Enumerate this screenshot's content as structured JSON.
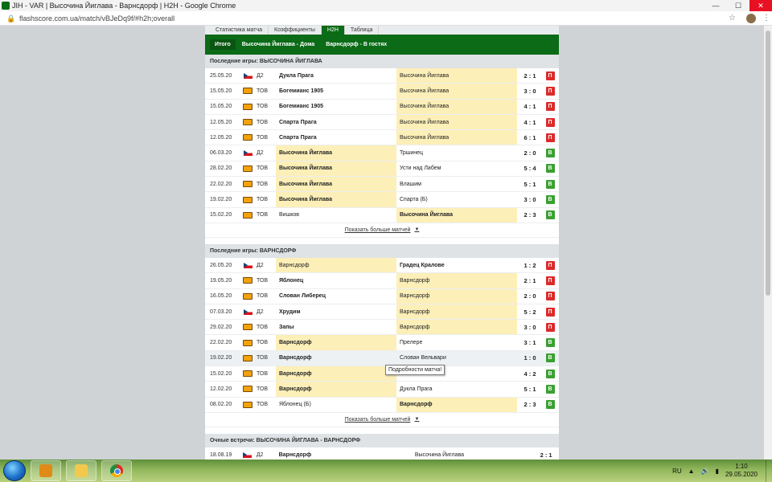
{
  "window": {
    "title": "JIH - VAR | Высочина Йиглава - Варнсдорф | H2H - Google Chrome",
    "url": "flashscore.com.ua/match/vBJeDq9f/#h2h;overall",
    "min": "—",
    "max": "☐",
    "close": "✕"
  },
  "top_tabs": [
    "Статистика матча",
    "Коэффициенты",
    "H2H",
    "Таблица"
  ],
  "sub_tabs": [
    "Итого",
    "Высочина Йиглава - Дома",
    "Варнсдорф - В гостях"
  ],
  "section1": {
    "title": "Последние игры: ВЫСОЧИНА ЙИГЛАВА",
    "rows": [
      {
        "date": "25.05.20",
        "flag": "cz",
        "comp": "Д2",
        "home": "Дукла Прага",
        "away": "Высочина Йиглава",
        "score": "2 : 1",
        "result": "П",
        "hl": "away",
        "bold": "home"
      },
      {
        "date": "15.05.20",
        "flag": "club",
        "comp": "ТОВ",
        "home": "Богемианс 1905",
        "away": "Высочина Йиглава",
        "score": "3 : 0",
        "result": "П",
        "hl": "away",
        "bold": "home"
      },
      {
        "date": "15.05.20",
        "flag": "club",
        "comp": "ТОВ",
        "home": "Богемианс 1905",
        "away": "Высочина Йиглава",
        "score": "4 : 1",
        "result": "П",
        "hl": "away",
        "bold": "home"
      },
      {
        "date": "12.05.20",
        "flag": "club",
        "comp": "ТОВ",
        "home": "Спарта Прага",
        "away": "Высочина Йиглава",
        "score": "4 : 1",
        "result": "П",
        "hl": "away",
        "bold": "home"
      },
      {
        "date": "12.05.20",
        "flag": "club",
        "comp": "ТОВ",
        "home": "Спарта Прага",
        "away": "Высочина Йиглава",
        "score": "6 : 1",
        "result": "П",
        "hl": "away",
        "bold": "home"
      },
      {
        "date": "06.03.20",
        "flag": "cz",
        "comp": "Д2",
        "home": "Высочина Йиглава",
        "away": "Тршинец",
        "score": "2 : 0",
        "result": "В",
        "hl": "home",
        "bold": "home"
      },
      {
        "date": "28.02.20",
        "flag": "club",
        "comp": "ТОВ",
        "home": "Высочина Йиглава",
        "away": "Усти над Лабем",
        "score": "5 : 4",
        "result": "В",
        "hl": "home",
        "bold": "home"
      },
      {
        "date": "22.02.20",
        "flag": "club",
        "comp": "ТОВ",
        "home": "Высочина Йиглава",
        "away": "Влашим",
        "score": "5 : 1",
        "result": "В",
        "hl": "home",
        "bold": "home"
      },
      {
        "date": "19.02.20",
        "flag": "club",
        "comp": "ТОВ",
        "home": "Высочина Йиглава",
        "away": "Спарта (Б)",
        "score": "3 : 0",
        "result": "В",
        "hl": "home",
        "bold": "home"
      },
      {
        "date": "15.02.20",
        "flag": "club",
        "comp": "ТОВ",
        "home": "Вишков",
        "away": "Высочина Йиглава",
        "score": "2 : 3",
        "result": "В",
        "hl": "away",
        "bold": "away"
      }
    ],
    "more": "Показать больше матчей"
  },
  "section2": {
    "title": "Последние игры: ВАРНСДОРФ",
    "rows": [
      {
        "date": "26.05.20",
        "flag": "cz",
        "comp": "Д2",
        "home": "Варнсдорф",
        "away": "Градец Кралове",
        "score": "1 : 2",
        "result": "П",
        "hl": "home",
        "bold": "away"
      },
      {
        "date": "19.05.20",
        "flag": "club",
        "comp": "ТОВ",
        "home": "Яблонец",
        "away": "Варнсдорф",
        "score": "2 : 1",
        "result": "П",
        "hl": "away",
        "bold": "home"
      },
      {
        "date": "16.05.20",
        "flag": "club",
        "comp": "ТОВ",
        "home": "Слован Либерец",
        "away": "Варнсдорф",
        "score": "2 : 0",
        "result": "П",
        "hl": "away",
        "bold": "home"
      },
      {
        "date": "07.03.20",
        "flag": "cz",
        "comp": "Д2",
        "home": "Хрудим",
        "away": "Варнсдорф",
        "score": "5 : 2",
        "result": "П",
        "hl": "away",
        "bold": "home"
      },
      {
        "date": "29.02.20",
        "flag": "club",
        "comp": "ТОВ",
        "home": "Запы",
        "away": "Варнсдорф",
        "score": "3 : 0",
        "result": "П",
        "hl": "away",
        "bold": "home"
      },
      {
        "date": "22.02.20",
        "flag": "club",
        "comp": "ТОВ",
        "home": "Варнсдорф",
        "away": "Прелерe",
        "score": "3 : 1",
        "result": "В",
        "hl": "home",
        "bold": "home"
      },
      {
        "date": "19.02.20",
        "flag": "club",
        "comp": "ТОВ",
        "home": "Варнсдорф",
        "away": "Слован Вельвари",
        "score": "1 : 0",
        "result": "В",
        "hl": "none",
        "bold": "home",
        "hovered": true
      },
      {
        "date": "15.02.20",
        "flag": "club",
        "comp": "ТОВ",
        "home": "Варнсдорф",
        "away": "",
        "score": "4 : 2",
        "result": "В",
        "hl": "home",
        "bold": "home"
      },
      {
        "date": "12.02.20",
        "flag": "club",
        "comp": "ТОВ",
        "home": "Варнсдорф",
        "away": "Дукла Прага",
        "score": "5 : 1",
        "result": "В",
        "hl": "home",
        "bold": "home"
      },
      {
        "date": "08.02.20",
        "flag": "club",
        "comp": "ТОВ",
        "home": "Яблонец (Б)",
        "away": "Варнсдорф",
        "score": "2 : 3",
        "result": "В",
        "hl": "away",
        "bold": "away"
      }
    ],
    "more": "Показать больше матчей"
  },
  "tooltip": "Подробности матча!",
  "section3": {
    "title": "Очные встречи: ВЫСОЧИНА ЙИГЛАВА - ВАРНСДОРФ",
    "rows": [
      {
        "date": "18.08.19",
        "flag": "cz",
        "comp": "Д2",
        "home": "Варнсдорф",
        "away": "Высочина Йиглава",
        "score": "2 : 1",
        "bold": "home"
      }
    ]
  },
  "taskbar": {
    "lang": "RU",
    "time": "1:10",
    "date": "29.05.2020"
  }
}
